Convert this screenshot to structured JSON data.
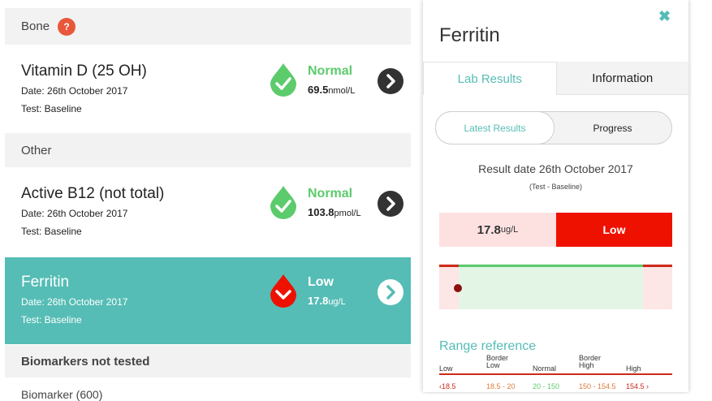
{
  "sections": {
    "bone": {
      "title": "Bone",
      "help": "?"
    },
    "other": {
      "title": "Other"
    },
    "not_tested": {
      "title": "Biomarkers not tested"
    }
  },
  "cards": [
    {
      "name": "Vitamin D (25 OH)",
      "date": "Date: 26th October 2017",
      "test": "Test: Baseline",
      "status": "Normal",
      "value": "69.5",
      "unit": "nmol/L"
    },
    {
      "name": "Active B12 (not total)",
      "date": "Date: 26th October 2017",
      "test": "Test: Baseline",
      "status": "Normal",
      "value": "103.8",
      "unit": "pmol/L"
    },
    {
      "name": "Ferritin",
      "date": "Date: 26th October 2017",
      "test": "Test: Baseline",
      "status": "Low",
      "value": "17.8",
      "unit": "ug/L"
    }
  ],
  "clipped_item": "Biomarker (600)",
  "panel": {
    "title": "Ferritin",
    "close": "✖",
    "tabs": [
      "Lab Results",
      "Information"
    ],
    "segments": [
      "Latest Results",
      "Progress"
    ],
    "result_date": "Result date 26th October 2017",
    "result_test": "(Test - Baseline)",
    "result_value": "17.8",
    "result_unit": "ug/L",
    "result_status": "Low",
    "range_heading": "Range reference",
    "range_cols": [
      "Low",
      "Border Low",
      "Normal",
      "Border High",
      "High"
    ],
    "range_values": [
      "‹18.5",
      "18.5 - 20",
      "20 - 150",
      "150 - 154.5",
      "154.5 ›"
    ],
    "gauge_level": 0.08
  },
  "colors": {
    "accent": "#55bdb5",
    "normal": "#5ccb6c",
    "low": "#ee1100",
    "help": "#e8573a",
    "range": [
      "#cc2a1a",
      "#e07a3a",
      "#5ccb6c",
      "#e07a3a",
      "#cc2a1a"
    ]
  }
}
